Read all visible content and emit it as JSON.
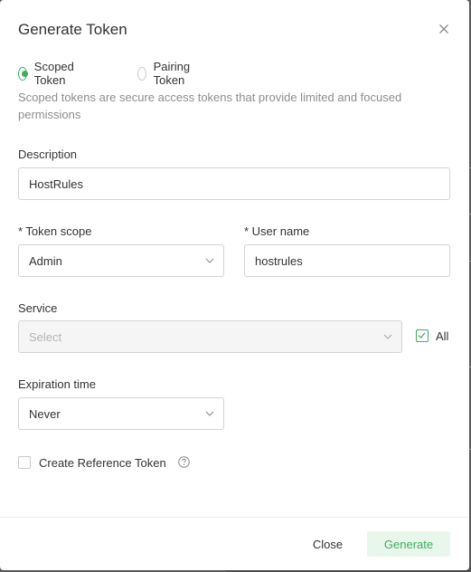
{
  "dialog": {
    "title": "Generate Token",
    "close_icon": "close-icon"
  },
  "token_type": {
    "options": [
      {
        "label": "Scoped Token",
        "checked": true
      },
      {
        "label": "Pairing Token",
        "checked": false
      }
    ],
    "description": "Scoped tokens are secure access tokens that provide limited and focused permissions"
  },
  "form": {
    "description": {
      "label": "Description",
      "value": "HostRules"
    },
    "token_scope": {
      "label": "* Token scope",
      "value": "Admin"
    },
    "user_name": {
      "label": "* User name",
      "value": "hostrules"
    },
    "service": {
      "label": "Service",
      "placeholder": "Select",
      "all_label": "All",
      "all_checked": true
    },
    "expiration": {
      "label": "Expiration time",
      "value": "Never"
    },
    "reference_token": {
      "label": "Create Reference Token",
      "checked": false,
      "help_icon": "help-circle-icon"
    }
  },
  "footer": {
    "close_label": "Close",
    "generate_label": "Generate"
  },
  "colors": {
    "accent": "#3fae5d",
    "accent_bg": "#e9f6ec"
  }
}
